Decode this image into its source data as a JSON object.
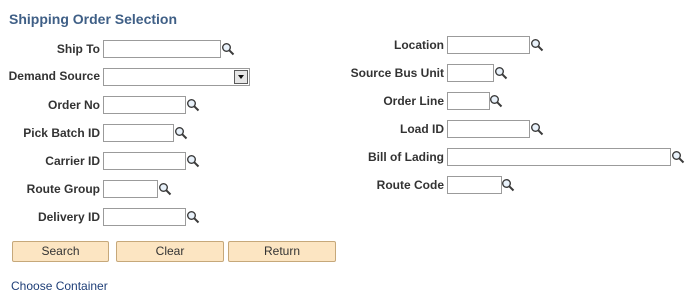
{
  "page": {
    "title": "Shipping Order Selection"
  },
  "left_fields": {
    "ship_to": {
      "label": "Ship To",
      "value": ""
    },
    "demand_source": {
      "label": "Demand Source",
      "selected": ""
    },
    "order_no": {
      "label": "Order No",
      "value": ""
    },
    "pick_batch_id": {
      "label": "Pick Batch ID",
      "value": ""
    },
    "carrier_id": {
      "label": "Carrier ID",
      "value": ""
    },
    "route_group": {
      "label": "Route Group",
      "value": ""
    },
    "delivery_id": {
      "label": "Delivery ID",
      "value": ""
    }
  },
  "right_fields": {
    "location": {
      "label": "Location",
      "value": ""
    },
    "source_bus_unit": {
      "label": "Source Bus Unit",
      "value": ""
    },
    "order_line": {
      "label": "Order Line",
      "value": ""
    },
    "load_id": {
      "label": "Load ID",
      "value": ""
    },
    "bill_of_lading": {
      "label": "Bill of Lading",
      "value": ""
    },
    "route_code": {
      "label": "Route Code",
      "value": ""
    }
  },
  "buttons": {
    "search": "Search",
    "clear": "Clear",
    "return": "Return"
  },
  "links": {
    "choose_container": "Choose Container"
  },
  "icons": {
    "lookup": "magnifier-icon",
    "dropdown": "chevron-down-icon"
  },
  "colors": {
    "title": "#3f5f86",
    "button_bg": "#fce5c2",
    "link": "#1f3f78"
  }
}
